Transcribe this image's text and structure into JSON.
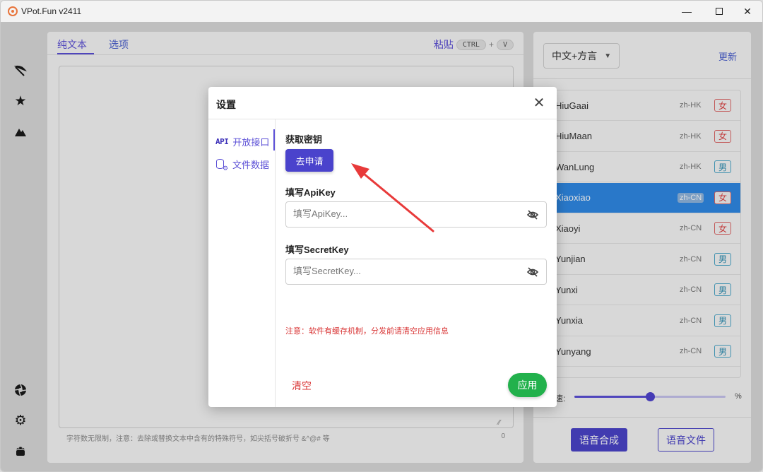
{
  "window": {
    "title": "VPot.Fun v2411",
    "minimize": "—",
    "close": "✕"
  },
  "rail": {
    "icons": [
      "umbrella-icon",
      "star-icon",
      "mountain-icon",
      "aperture-icon",
      "gear-icon",
      "android-icon"
    ]
  },
  "editor": {
    "tabs": [
      "纯文本",
      "选项"
    ],
    "paste_label": "粘贴",
    "key_ctrl": "CTRL",
    "key_plus": "+",
    "key_v": "V",
    "text_value": "",
    "hint": "字符数无限制，注意：去除或替换文本中含有的特殊符号，如尖括号破折号 &^@# 等",
    "char_count": "0"
  },
  "voice_panel": {
    "language": "中文+方言",
    "update_label": "更新",
    "voices": [
      {
        "name": "HiuGaai",
        "lang": "zh-HK",
        "gender": "女",
        "selected": false
      },
      {
        "name": "HiuMaan",
        "lang": "zh-HK",
        "gender": "女",
        "selected": false
      },
      {
        "name": "WanLung",
        "lang": "zh-HK",
        "gender": "男",
        "selected": false
      },
      {
        "name": "Xiaoxiao",
        "lang": "zh-CN",
        "gender": "女",
        "selected": true
      },
      {
        "name": "Xiaoyi",
        "lang": "zh-CN",
        "gender": "女",
        "selected": false
      },
      {
        "name": "Yunjian",
        "lang": "zh-CN",
        "gender": "男",
        "selected": false
      },
      {
        "name": "Yunxi",
        "lang": "zh-CN",
        "gender": "男",
        "selected": false
      },
      {
        "name": "Yunxia",
        "lang": "zh-CN",
        "gender": "男",
        "selected": false
      },
      {
        "name": "Yunyang",
        "lang": "zh-CN",
        "gender": "男",
        "selected": false
      }
    ],
    "speed_label": "速:",
    "speed_fraction": 0.5,
    "speed_unit": "%",
    "synth_button": "语音合成",
    "file_button": "语音文件"
  },
  "settings_dialog": {
    "title": "设置",
    "close": "✕",
    "nav": {
      "api_glyph": "API",
      "api_label": "开放接口",
      "files_label": "文件数据"
    },
    "get_key_label": "获取密钥",
    "apply_key_button": "去申请",
    "apikey_label": "填写ApiKey",
    "apikey_placeholder": "填写ApiKey...",
    "apikey_value": "",
    "secretkey_label": "填写SecretKey",
    "secretkey_placeholder": "填写SecretKey...",
    "secretkey_value": "",
    "warning": "注意：软件有缓存机制，分发前请清空应用信息",
    "clear_button": "清空",
    "apply_button": "应用"
  },
  "colors": {
    "accent": "#5b4fd6",
    "selected_row": "#2f89e5",
    "apply_green": "#22b14c",
    "warning_red": "#d93636",
    "annotation_arrow": "#e83a3a"
  }
}
